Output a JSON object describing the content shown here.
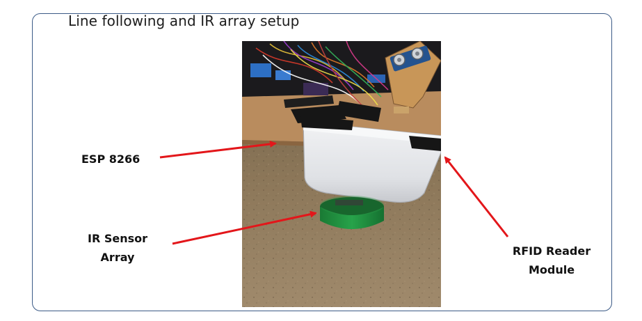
{
  "slide": {
    "title": "Line following and IR array setup"
  },
  "labels": {
    "esp": "ESP 8266",
    "ir_line1": "IR Sensor",
    "ir_line2": "Array",
    "rfid_line1": "RFID Reader",
    "rfid_line2": "Module"
  },
  "colors": {
    "frame_border": "#3b5a86",
    "arrow": "#e3161a",
    "floor": "#8a7558",
    "container": "#e6e8ec",
    "cap": "#1f8f3c",
    "tape": "#161616",
    "board": "#b98c5e"
  }
}
